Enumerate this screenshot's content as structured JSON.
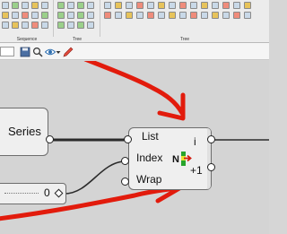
{
  "ribbon": {
    "panels": [
      {
        "label": "Sequence",
        "cells": 20
      },
      {
        "label": "Tree",
        "cells": 12
      },
      {
        "label": "Tree",
        "cells": 28
      }
    ]
  },
  "canvas": {
    "series_component": {
      "label": "Series"
    },
    "list_item_component": {
      "inputs": [
        "List",
        "Index",
        "Wrap"
      ],
      "outputs": [
        "i",
        "+1"
      ],
      "icon_letter": "N"
    },
    "number_slider": {
      "value": "0"
    }
  },
  "colors": {
    "canvas": "#d4d4d4",
    "component_fill": "#efefef",
    "wire": "#2b2b2b",
    "annotation": "#e21b0c"
  }
}
